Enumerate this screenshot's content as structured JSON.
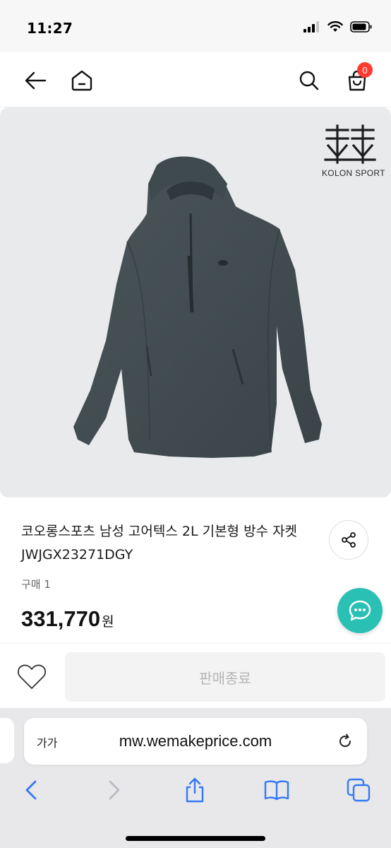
{
  "status_bar": {
    "time": "11:27"
  },
  "header": {
    "cart_count": "0"
  },
  "product": {
    "brand_logo_text": "KOLON SPORT",
    "title": "코오롱스포츠 남성 고어텍스 2L 기본형 방수 자켓 JWJGX23271DGY",
    "purchase_count": "구매 1",
    "price": "331,770",
    "price_unit": "원"
  },
  "actions": {
    "sold_out_label": "판매종료"
  },
  "browser": {
    "text_size_label": "가가",
    "url": "mw.wemakeprice.com"
  },
  "colors": {
    "accent_chat": "#2bc0b4",
    "badge": "#ff3b30",
    "safari_blue": "#3478f6"
  }
}
